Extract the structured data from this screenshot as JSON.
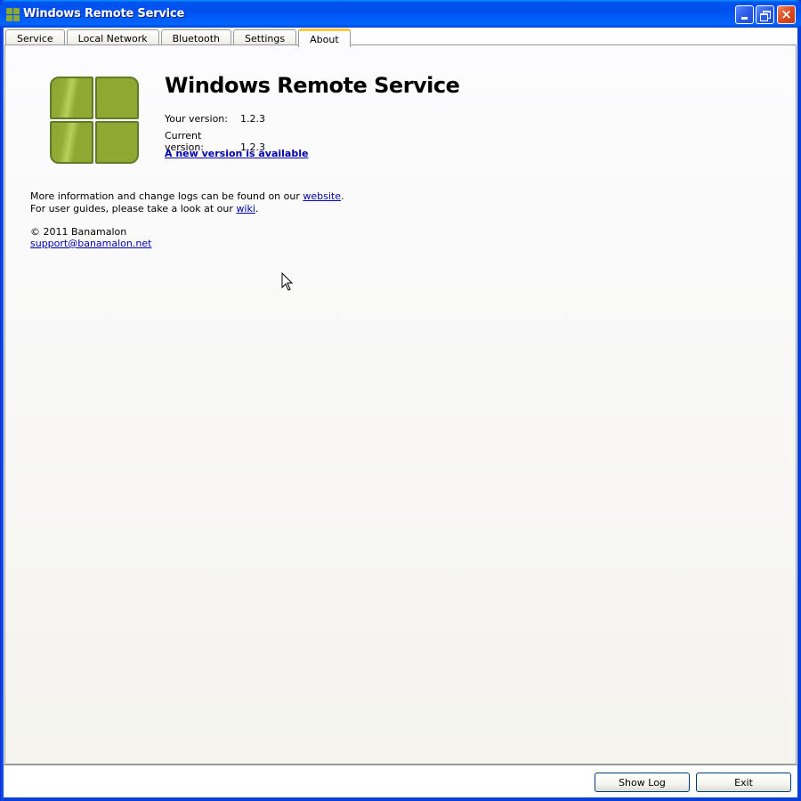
{
  "window": {
    "title": "Windows Remote Service",
    "controls": {
      "minimize": "minimize",
      "maximize": "restore",
      "close": "×"
    }
  },
  "tabs": [
    {
      "label": "Service",
      "active": false
    },
    {
      "label": "Local Network",
      "active": false
    },
    {
      "label": "Bluetooth",
      "active": false
    },
    {
      "label": "Settings",
      "active": false
    },
    {
      "label": "About",
      "active": true
    }
  ],
  "about": {
    "app_name": "Windows Remote Service",
    "your_version_label": "Your version:",
    "your_version": "1.2.3",
    "current_version_label": "Current version:",
    "current_version": "1.2.3",
    "new_version_link": "A new version is available",
    "info_line1_prefix": "More information and change logs can be found on our ",
    "info_line1_link": "website",
    "info_line1_suffix": ".",
    "info_line2_prefix": "For user guides, please take a look at our ",
    "info_line2_link": "wiki",
    "info_line2_suffix": ".",
    "copyright": "© 2011 Banamalon",
    "support_email": "support@banamalon.net"
  },
  "footer": {
    "show_log_label": "Show Log",
    "exit_label": "Exit"
  },
  "colors": {
    "logo_green": "#8ea832",
    "link": "#0000aa",
    "active_tab_accent": "#ffc83c",
    "titlebar_blue": "#0053ee"
  }
}
